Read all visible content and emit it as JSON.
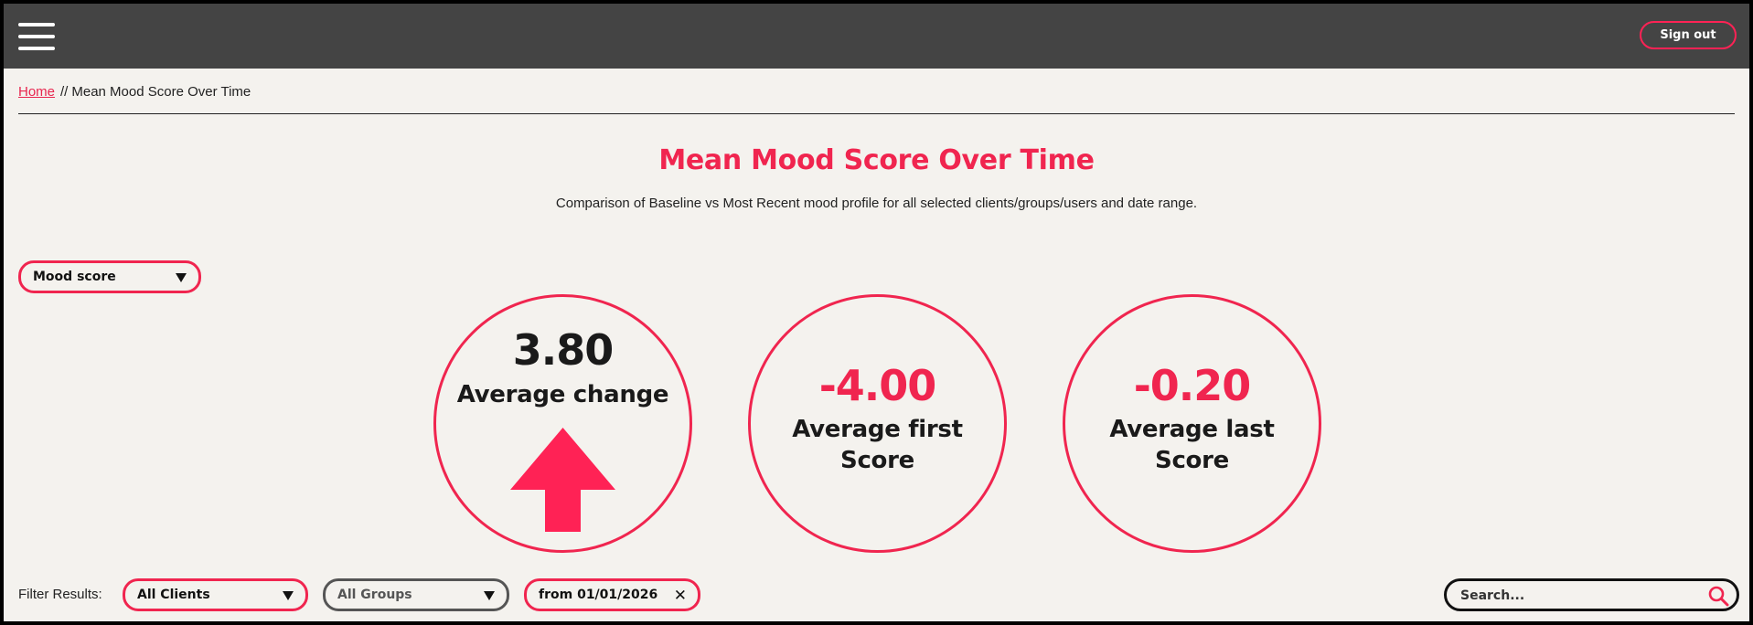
{
  "header": {
    "menu_icon": "hamburger-icon",
    "sign_out_label": "Sign out"
  },
  "breadcrumb": {
    "home_label": "Home",
    "separator": "//",
    "current": "Mean Mood Score Over Time"
  },
  "page": {
    "title": "Mean Mood Score Over Time",
    "subtitle": "Comparison of Baseline vs Most Recent mood profile for all selected clients/groups/users and date range."
  },
  "metric_select": {
    "selected": "Mood score"
  },
  "stats": [
    {
      "value": "3.80",
      "label": "Average change",
      "indicator": "up-arrow-icon"
    },
    {
      "value": "-4.00",
      "label": "Average first Score"
    },
    {
      "value": "-0.20",
      "label": "Average last Score"
    }
  ],
  "filters": {
    "label": "Filter Results:",
    "clients": "All Clients",
    "groups": "All Groups",
    "date_chip": "from 01/01/2026",
    "search_placeholder": "Search..."
  },
  "colors": {
    "accent": "#f0254f",
    "topbar": "#444444",
    "background": "#f4f2ee",
    "text": "#1a1a1a"
  }
}
